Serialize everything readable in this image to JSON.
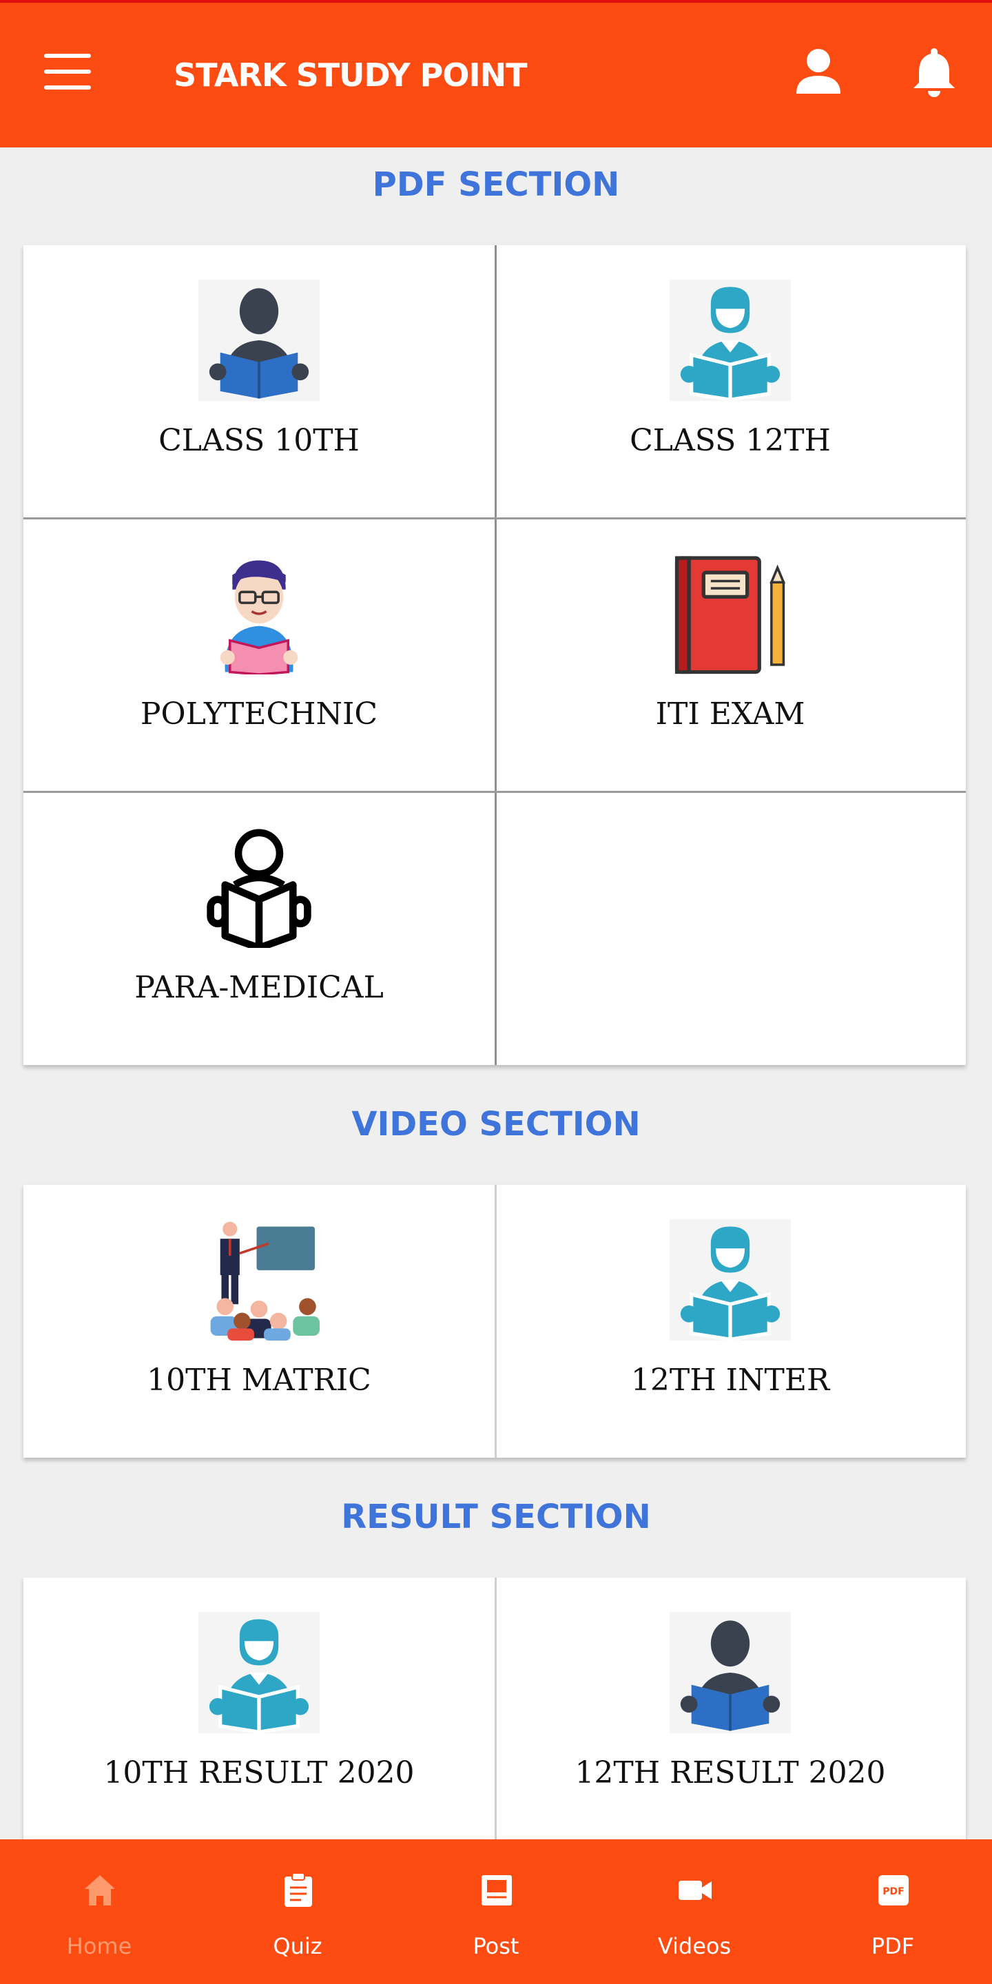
{
  "appbar": {
    "title": "STARK STUDY POINT",
    "menu_icon": "hamburger-menu-icon",
    "profile_icon": "person-icon",
    "notification_icon": "bell-icon"
  },
  "sections": {
    "pdf": {
      "title": "PDF SECTION",
      "items": [
        {
          "label": "CLASS 10TH",
          "icon": "student-reading-dark-icon"
        },
        {
          "label": "CLASS 12TH",
          "icon": "student-reading-teal-icon"
        },
        {
          "label": "POLYTECHNIC",
          "icon": "student-glasses-reading-icon"
        },
        {
          "label": "ITI EXAM",
          "icon": "notebook-pencil-icon"
        },
        {
          "label": "PARA-MEDICAL",
          "icon": "reader-outline-icon"
        }
      ]
    },
    "video": {
      "title": "VIDEO SECTION",
      "items": [
        {
          "label": "10TH MATRIC",
          "icon": "teacher-classroom-icon"
        },
        {
          "label": "12TH INTER",
          "icon": "student-reading-teal-icon"
        }
      ]
    },
    "result": {
      "title": "RESULT SECTION",
      "items": [
        {
          "label": "10TH RESULT 2020",
          "icon": "student-reading-teal-icon"
        },
        {
          "label": "12TH RESULT 2020",
          "icon": "student-reading-dark-icon"
        }
      ]
    }
  },
  "bottom_nav": {
    "items": [
      {
        "label": "Home",
        "icon": "home-icon",
        "active": true
      },
      {
        "label": "Quiz",
        "icon": "clipboard-icon"
      },
      {
        "label": "Post",
        "icon": "post-icon"
      },
      {
        "label": "Videos",
        "icon": "video-camera-icon"
      },
      {
        "label": "PDF",
        "icon": "pdf-icon",
        "badge": "PDF"
      }
    ]
  },
  "colors": {
    "primary": "#fd4c12",
    "section_title": "#3f74db",
    "home_inactive": "#ff9a6e"
  }
}
